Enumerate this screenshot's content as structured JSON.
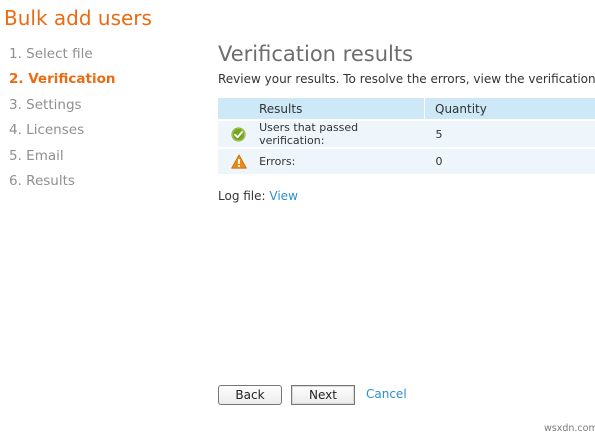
{
  "wizard": {
    "title": "Bulk add users",
    "steps": [
      {
        "label": "1. Select file"
      },
      {
        "label": "2. Verification"
      },
      {
        "label": "3. Settings"
      },
      {
        "label": "4. Licenses"
      },
      {
        "label": "5. Email"
      },
      {
        "label": "6. Results"
      }
    ],
    "active_step": 1
  },
  "main": {
    "heading": "Verification results",
    "subtitle": "Review your results. To resolve the errors, view the verification log,",
    "table": {
      "headers": [
        "Results",
        "Quantity"
      ],
      "rows": [
        {
          "icon": "check-circle-icon",
          "label": "Users that passed verification:",
          "quantity": "5"
        },
        {
          "icon": "warning-triangle-icon",
          "label": "Errors:",
          "quantity": "0"
        }
      ]
    },
    "log_file": {
      "label": "Log file:",
      "link": "View"
    }
  },
  "footer": {
    "back_label": "Back",
    "next_label": "Next",
    "cancel_label": "Cancel"
  },
  "watermark": "wsxdn.com",
  "colors": {
    "accent_orange": "#eb6b13",
    "link_blue": "#2b8fc9",
    "header_blue": "#cde8f7",
    "row_blue": "#eef6fb",
    "ok_green": "#78a421",
    "warn_orange": "#e98a16"
  }
}
